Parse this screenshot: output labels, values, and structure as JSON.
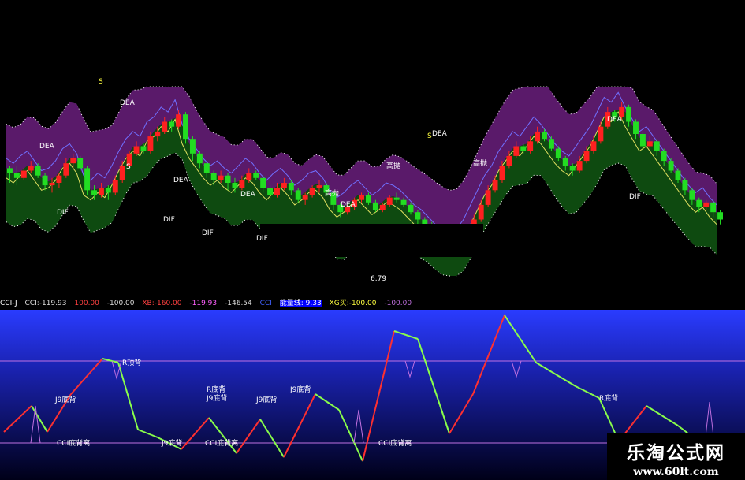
{
  "colors": {
    "up": "#ff2020",
    "down": "#22dd22",
    "bollUpper": "#5a1a6a",
    "bollLower": "#0e4a10",
    "lowerBgTop": "#2a3cff",
    "lowerBgBot": "#000010",
    "oscUp": "#ff3030",
    "oscDown": "#8aff4a",
    "refLine": "#c070e0",
    "annot": "#ffffff"
  },
  "status_bar": {
    "name": "CCI-J",
    "cci": "CCI:-119.93",
    "v1": "100.00",
    "v2": "-100.00",
    "xb": "XB:-160.00",
    "v3": "-119.93",
    "v4": "-146.54",
    "v5": "CCI",
    "flag": "能量线: 9.33",
    "xg": "XG买:-100.00",
    "v6": "-100.00"
  },
  "watermark": {
    "cn": "乐淘公式网",
    "url": "www.60lt.com"
  },
  "chart_data": [
    {
      "type": "candlestick",
      "panel": "price",
      "candles": [
        [
          51,
          49,
          45,
          52
        ],
        [
          49,
          47,
          44,
          52
        ],
        [
          47,
          50,
          46,
          51
        ],
        [
          50,
          52,
          49,
          54
        ],
        [
          52,
          48,
          47,
          53
        ],
        [
          48,
          44,
          42,
          49
        ],
        [
          44,
          45,
          41,
          47
        ],
        [
          45,
          48,
          43,
          49
        ],
        [
          48,
          53,
          47,
          55
        ],
        [
          53,
          55,
          51,
          57
        ],
        [
          55,
          51,
          50,
          56
        ],
        [
          51,
          42,
          40,
          52
        ],
        [
          42,
          40,
          38,
          44
        ],
        [
          40,
          43,
          39,
          45
        ],
        [
          43,
          41,
          38,
          44
        ],
        [
          41,
          46,
          40,
          48
        ],
        [
          46,
          52,
          45,
          54
        ],
        [
          52,
          57,
          51,
          58
        ],
        [
          57,
          60,
          56,
          62
        ],
        [
          60,
          58,
          57,
          61
        ],
        [
          58,
          64,
          57,
          66
        ],
        [
          64,
          66,
          62,
          68
        ],
        [
          66,
          70,
          65,
          72
        ],
        [
          70,
          68,
          66,
          71
        ],
        [
          68,
          73,
          67,
          75
        ],
        [
          73,
          63,
          61,
          74
        ],
        [
          63,
          57,
          54,
          64
        ],
        [
          57,
          53,
          51,
          58
        ],
        [
          53,
          49,
          47,
          54
        ],
        [
          49,
          46,
          44,
          50
        ],
        [
          46,
          48,
          45,
          50
        ],
        [
          48,
          45,
          42,
          49
        ],
        [
          45,
          43,
          41,
          47
        ],
        [
          43,
          46,
          42,
          48
        ],
        [
          46,
          49,
          45,
          51
        ],
        [
          49,
          47,
          46,
          50
        ],
        [
          47,
          43,
          41,
          48
        ],
        [
          43,
          40,
          38,
          44
        ],
        [
          40,
          43,
          39,
          45
        ],
        [
          43,
          45,
          42,
          47
        ],
        [
          45,
          42,
          40,
          46
        ],
        [
          42,
          38,
          37,
          43
        ],
        [
          38,
          40,
          36,
          41
        ],
        [
          40,
          43,
          39,
          44
        ],
        [
          43,
          44,
          41,
          46
        ],
        [
          44,
          41,
          40,
          45
        ],
        [
          41,
          36,
          34,
          42
        ],
        [
          36,
          33,
          31,
          37
        ],
        [
          33,
          35,
          32,
          36
        ],
        [
          35,
          38,
          34,
          39
        ],
        [
          38,
          40,
          37,
          41
        ],
        [
          40,
          37,
          36,
          41
        ],
        [
          37,
          34,
          33,
          38
        ],
        [
          34,
          36,
          33,
          37
        ],
        [
          36,
          39,
          35,
          40
        ],
        [
          39,
          38,
          37,
          41
        ],
        [
          38,
          36,
          35,
          39
        ],
        [
          36,
          33,
          32,
          37
        ],
        [
          33,
          30,
          28,
          34
        ],
        [
          30,
          28,
          26,
          31
        ],
        [
          28,
          25,
          23,
          29
        ],
        [
          25,
          22,
          20,
          26
        ],
        [
          22,
          20,
          18,
          23
        ],
        [
          20,
          18,
          16,
          21
        ],
        [
          18,
          20,
          17,
          22
        ],
        [
          20,
          24,
          19,
          26
        ],
        [
          24,
          30,
          23,
          32
        ],
        [
          30,
          36,
          29,
          38
        ],
        [
          36,
          42,
          35,
          44
        ],
        [
          42,
          46,
          41,
          48
        ],
        [
          46,
          52,
          45,
          54
        ],
        [
          52,
          56,
          51,
          58
        ],
        [
          56,
          60,
          55,
          62
        ],
        [
          60,
          58,
          57,
          61
        ],
        [
          58,
          62,
          57,
          64
        ],
        [
          62,
          66,
          61,
          68
        ],
        [
          66,
          63,
          62,
          67
        ],
        [
          63,
          59,
          58,
          64
        ],
        [
          59,
          55,
          54,
          60
        ],
        [
          55,
          52,
          50,
          56
        ],
        [
          52,
          50,
          48,
          53
        ],
        [
          50,
          54,
          49,
          56
        ],
        [
          54,
          58,
          53,
          60
        ],
        [
          58,
          62,
          57,
          64
        ],
        [
          62,
          68,
          61,
          70
        ],
        [
          68,
          74,
          67,
          76
        ],
        [
          74,
          72,
          70,
          75
        ],
        [
          72,
          76,
          71,
          78
        ],
        [
          76,
          70,
          68,
          77
        ],
        [
          70,
          65,
          63,
          71
        ],
        [
          65,
          60,
          58,
          66
        ],
        [
          60,
          62,
          59,
          64
        ],
        [
          62,
          58,
          56,
          63
        ],
        [
          58,
          54,
          52,
          59
        ],
        [
          54,
          50,
          49,
          55
        ],
        [
          50,
          46,
          45,
          51
        ],
        [
          46,
          42,
          40,
          47
        ],
        [
          42,
          38,
          36,
          43
        ],
        [
          38,
          35,
          33,
          39
        ],
        [
          35,
          37,
          34,
          38
        ],
        [
          37,
          33,
          31,
          38
        ],
        [
          33,
          30,
          28,
          34
        ]
      ],
      "labels": [
        "S",
        "DEA",
        "DEA",
        "DIF",
        "S",
        "DEA",
        "DIF",
        "DEA",
        "DIF",
        "高抛",
        "DEA",
        "DIF",
        "高抛",
        "S",
        "DEA",
        "高抛",
        "DEA",
        "DIF",
        "6.79"
      ]
    },
    {
      "type": "line",
      "panel": "oscillator",
      "title": "CCI-J",
      "ref_lines": [
        0.85,
        0.12
      ],
      "labels": [
        "J9底背",
        "CCI底背离",
        "CCI底背离",
        "R顶背",
        "J9底背",
        "R底背",
        "J9底背",
        "J9底背",
        "R底背",
        "CCI底背离",
        "J9底背"
      ]
    }
  ]
}
